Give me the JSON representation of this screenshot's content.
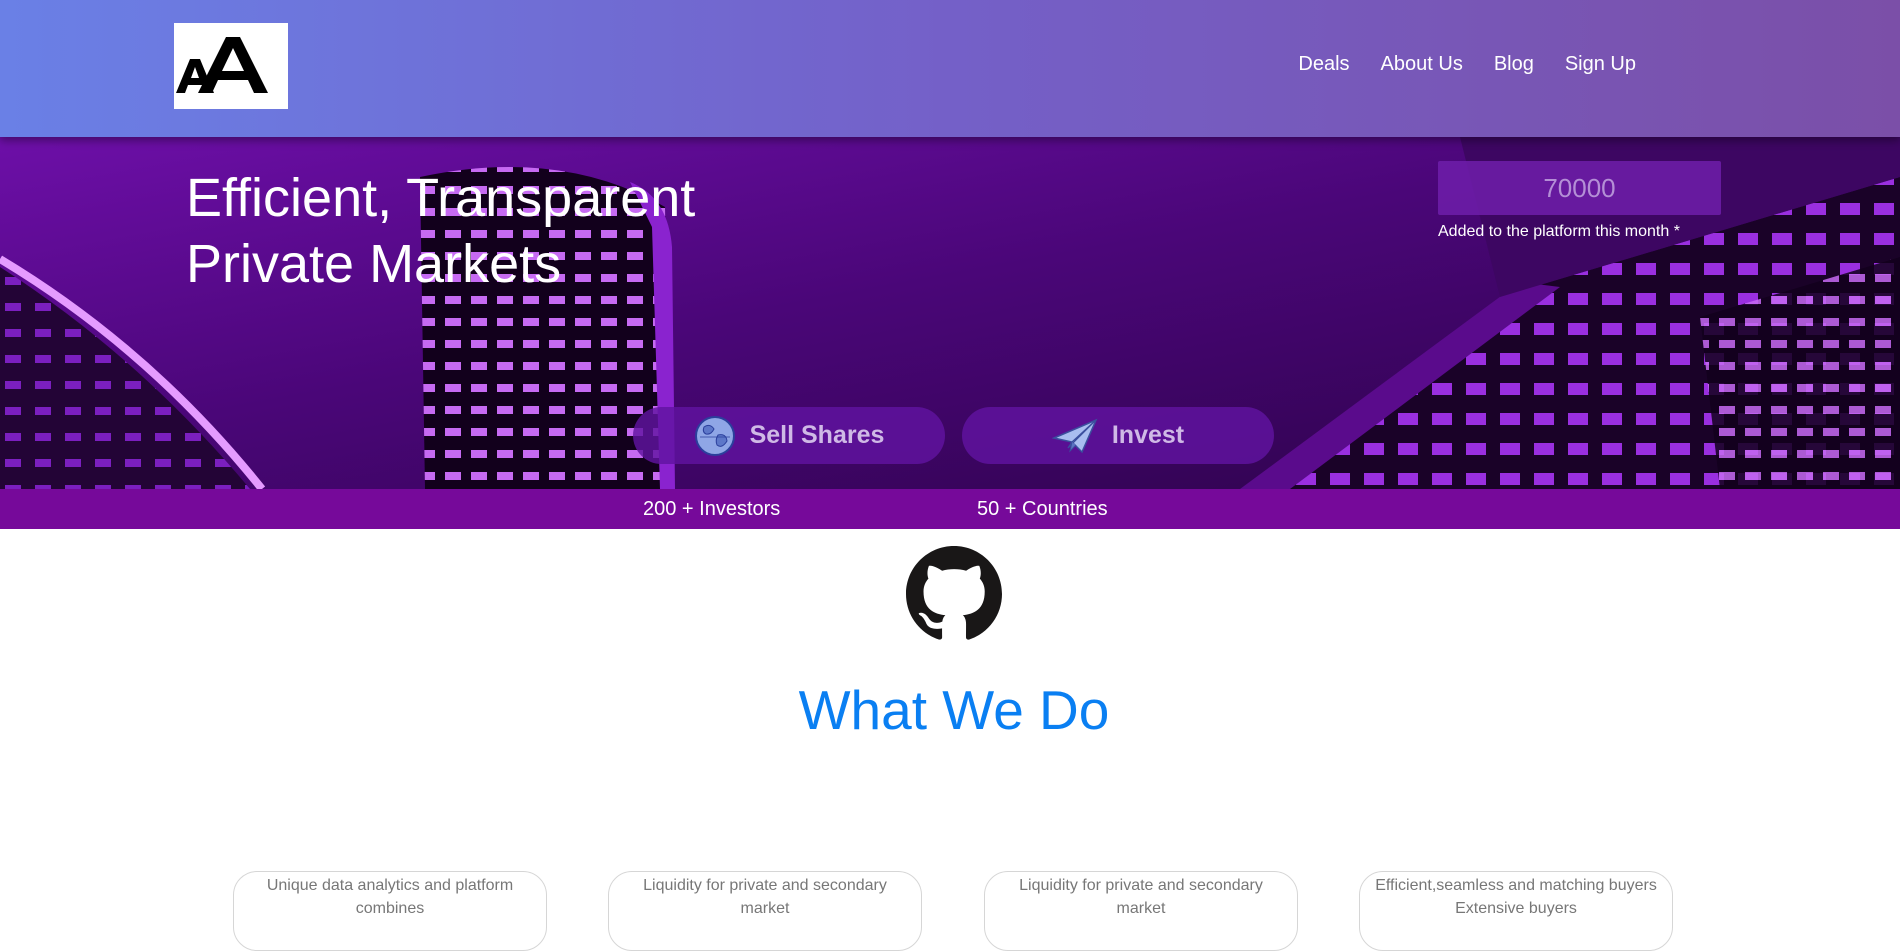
{
  "header": {
    "logo_text": "AA",
    "nav": [
      {
        "label": "Deals"
      },
      {
        "label": "About Us"
      },
      {
        "label": "Blog"
      },
      {
        "label": "Sign Up"
      }
    ]
  },
  "hero": {
    "title_line1": "Efficient, Transparent",
    "title_line2": "Private Markets",
    "counter_value": "70000",
    "counter_note": "Added to the platform this month *",
    "buttons": [
      {
        "label": "Sell Shares",
        "icon": "globe-icon"
      },
      {
        "label": "Invest",
        "icon": "paper-plane-icon"
      }
    ]
  },
  "stats": [
    {
      "label": "200 + Investors"
    },
    {
      "label": "50 + Countries"
    }
  ],
  "main": {
    "icon": "github-icon",
    "title": "What We Do",
    "cards": [
      {
        "line1": "Unique data analytics and platform",
        "line2": "combines"
      },
      {
        "line1": "Liquidity for private and secondary",
        "line2": "market"
      },
      {
        "line1": "Liquidity for private and secondary",
        "line2": "market"
      },
      {
        "line1": "Efficient,seamless and matching buyers",
        "line2": "Extensive buyers"
      }
    ]
  },
  "colors": {
    "header_gradient_start": "#6a80e6",
    "header_gradient_end": "#7b4fa8",
    "hero_purple": "#7a14c0",
    "stats_bar": "#76099a",
    "title_blue": "#0a7ff2"
  }
}
